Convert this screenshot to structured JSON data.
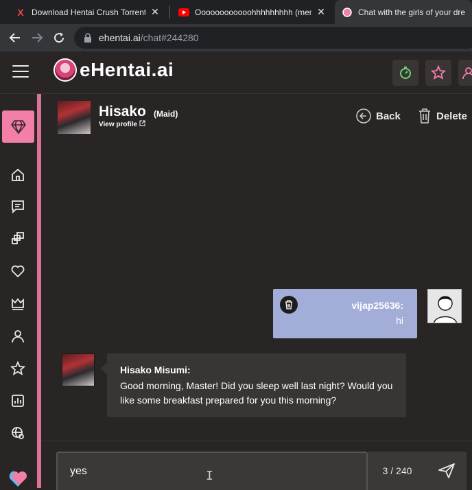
{
  "browser": {
    "tabs": [
      {
        "title": "Download Hentai Crush Torrent",
        "favicon": "x-logo-icon",
        "color": "#e8453c"
      },
      {
        "title": "Oooooooooooohhhhhhhhh (mem",
        "favicon": "youtube-icon",
        "color": "#ff0000"
      },
      {
        "title": "Chat with the girls of your dream",
        "favicon": "ehentai-icon",
        "color": "#f27fa7"
      }
    ],
    "url_host": "ehentai.ai",
    "url_path": "/chat#244280"
  },
  "site": {
    "logo_text": "eHentai.ai",
    "accent": "#f27fa7"
  },
  "character": {
    "name": "Hisako",
    "role": "(Maid)",
    "profile_link": "View profile"
  },
  "actions": {
    "back_label": "Back",
    "delete_label": "Delete"
  },
  "messages": {
    "user": {
      "author": "vijap25636:",
      "text": "hi"
    },
    "bot": {
      "author": "Hisako Misumi:",
      "text": "Good morning, Master! Did you sleep well last night? Would you like some breakfast prepared for you this morning?"
    }
  },
  "composer": {
    "value": "yes",
    "counter": "3 / 240"
  }
}
